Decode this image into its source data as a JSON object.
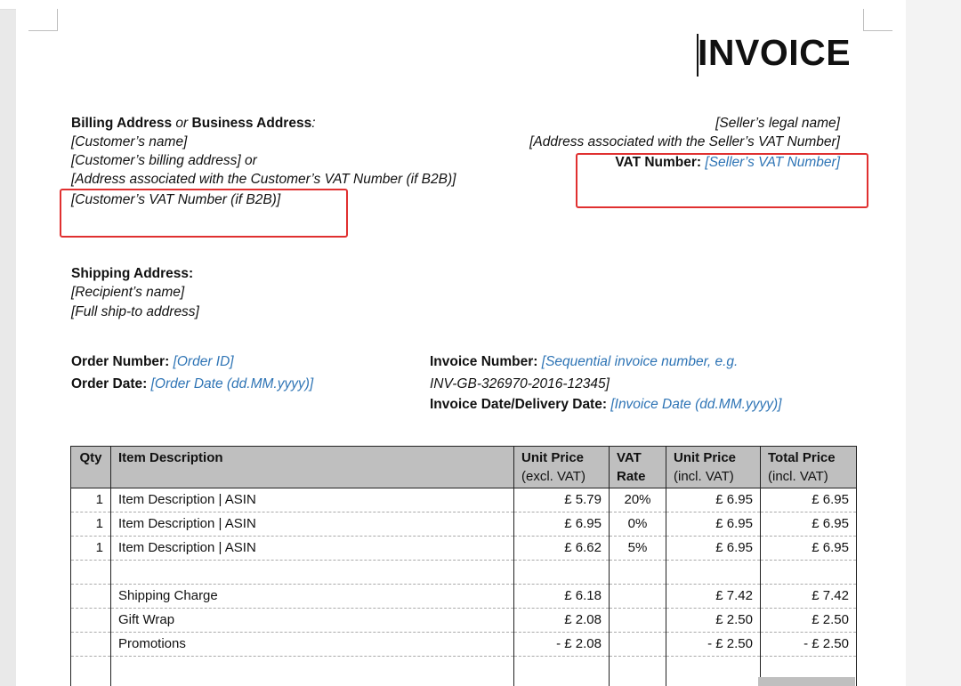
{
  "title": "INVOICE",
  "billing": {
    "heading_bold1": "Billing Address",
    "heading_or": "or",
    "heading_bold2": "Business Address",
    "heading_colon": ":",
    "lines": [
      "[Customer’s name]",
      "[Customer’s billing address] or",
      "[Address associated with the Customer’s VAT Number (if B2B)]",
      "[Customer’s VAT Number (if B2B)]"
    ]
  },
  "seller": {
    "lines": [
      "[Seller’s legal name]",
      "[Address associated with the Seller’s VAT Number]"
    ],
    "vat_label": "VAT Number:",
    "vat_value": "[Seller’s VAT Number]"
  },
  "shipping": {
    "heading": "Shipping Address:",
    "lines": [
      "[Recipient’s name]",
      "[Full ship-to address]"
    ]
  },
  "order": {
    "number_label": "Order Number:",
    "number_value": "[Order ID]",
    "date_label": "Order Date:",
    "date_value": "[Order Date (dd.MM.yyyy)]"
  },
  "invoice_meta": {
    "number_label": "Invoice Number:",
    "number_value_1": "[Sequential invoice number, e.g.",
    "number_value_2": "INV-GB-326970-2016-12345]",
    "date_label": "Invoice Date/Delivery Date:",
    "date_value": "[Invoice Date (dd.MM.yyyy)]"
  },
  "table": {
    "headers": {
      "qty": "Qty",
      "desc": "Item Description",
      "unit_excl_1": "Unit Price",
      "unit_excl_2": "(excl. VAT)",
      "vat_1": "VAT",
      "vat_2": "Rate",
      "unit_incl_1": "Unit Price",
      "unit_incl_2": "(incl. VAT)",
      "total_1": "Total Price",
      "total_2": "(incl. VAT)"
    },
    "rows": [
      {
        "qty": "1",
        "desc": "Item Description | ASIN",
        "unit_excl": "£ 5.79",
        "vat": "20%",
        "unit_incl": "£ 6.95",
        "total": "£ 6.95"
      },
      {
        "qty": "1",
        "desc": "Item Description | ASIN",
        "unit_excl": "£ 6.95",
        "vat": "0%",
        "unit_incl": "£ 6.95",
        "total": "£ 6.95"
      },
      {
        "qty": "1",
        "desc": "Item Description | ASIN",
        "unit_excl": "£ 6.62",
        "vat": "5%",
        "unit_incl": "£ 6.95",
        "total": "£ 6.95"
      }
    ],
    "charges": [
      {
        "desc": "Shipping Charge",
        "unit_excl": "£ 6.18",
        "unit_incl": "£ 7.42",
        "total": "£ 7.42"
      },
      {
        "desc": "Gift Wrap",
        "unit_excl": "£ 2.08",
        "unit_incl": "£ 2.50",
        "total": "£ 2.50"
      },
      {
        "desc": "Promotions",
        "unit_excl": "- £ 2.08",
        "unit_incl": "- £ 2.50",
        "total": "- £ 2.50"
      }
    ]
  },
  "colors": {
    "placeholder_text": "#2e74b5",
    "highlight_box": "#e03030",
    "table_header_bg": "#bfbfbf"
  }
}
